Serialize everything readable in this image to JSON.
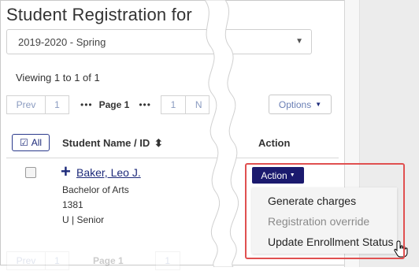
{
  "header": {
    "title": "Student Registration for"
  },
  "term_select": {
    "value": "2019-2020 - Spring",
    "caret": "▼"
  },
  "viewing": "Viewing 1 to 1 of 1",
  "pager": {
    "prev": "Prev",
    "first_page": "1",
    "ellipsis": "•••",
    "current": "Page 1",
    "last_page": "1",
    "next_partial": "N"
  },
  "options": {
    "label": "Options"
  },
  "table": {
    "select_all": "All",
    "col_name": "Student Name / ID",
    "sort_icon": "⬍",
    "col_action": "Action"
  },
  "student": {
    "expand": "+",
    "name": "Baker, Leo J.",
    "program": "Bachelor of Arts",
    "id": "1381",
    "level": "U | Senior"
  },
  "action_button": {
    "label": "Action"
  },
  "action_menu": {
    "items": [
      {
        "label": "Generate charges",
        "enabled": true
      },
      {
        "label": "Registration override",
        "enabled": false
      },
      {
        "label": "Update Enrollment Status",
        "enabled": true
      }
    ]
  },
  "ghost_pager": {
    "prev": "Prev",
    "one": "1",
    "page": "Page 1",
    "one2": "1"
  },
  "colors": {
    "accent": "#1d2a7a",
    "action_bg": "#1b1a6e",
    "highlight": "#e05050",
    "disabled": "#8a8a8a"
  }
}
